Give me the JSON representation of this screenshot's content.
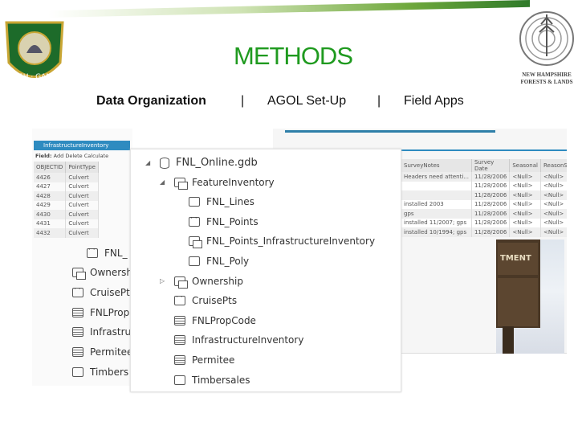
{
  "title": "METHODS",
  "nav": {
    "items": [
      "Data Organization",
      "AGOL Set-Up",
      "Field Apps"
    ],
    "separator": "|",
    "active": "Data Organization"
  },
  "logos": {
    "left": "FISH & GAME",
    "right": "NEW HAMPSHIRE FORESTS & LANDS"
  },
  "table_window": {
    "tab": "InfrastructureInventory",
    "toolbar": [
      "Field:",
      "Add",
      "Delete",
      "Calculate"
    ],
    "columns": [
      "OBJECTID",
      "PointType"
    ],
    "rows": [
      [
        "4426",
        "Culvert"
      ],
      [
        "4427",
        "Culvert"
      ],
      [
        "4428",
        "Culvert"
      ],
      [
        "4429",
        "Culvert"
      ],
      [
        "4430",
        "Culvert"
      ],
      [
        "4431",
        "Culvert"
      ],
      [
        "4432",
        "Culvert"
      ]
    ]
  },
  "table_right": {
    "columns": [
      "SurveyNotes",
      "Survey Date",
      "Seasonal",
      "ReasonSea"
    ],
    "rows": [
      [
        "Headers need attenti...",
        "11/28/2006",
        "<Null>",
        "<Null>"
      ],
      [
        "",
        "11/28/2006",
        "<Null>",
        "<Null>"
      ],
      [
        "",
        "11/28/2006",
        "<Null>",
        "<Null>"
      ],
      [
        "installed 2003",
        "11/28/2006",
        "<Null>",
        "<Null>"
      ],
      [
        "gps",
        "11/28/2006",
        "<Null>",
        "<Null>"
      ],
      [
        "installed 11/2007; gps",
        "11/28/2006",
        "<Null>",
        "<Null>"
      ],
      [
        "installed 10/1994; gps",
        "11/28/2006",
        "<Null>",
        "<Null>"
      ]
    ]
  },
  "back_tree": [
    "FNL_",
    "Ownersh",
    "CruisePt",
    "FNLProp",
    "Infrastru",
    "Permitee",
    "Timbers"
  ],
  "tree": [
    {
      "label": "FNL_Online.gdb",
      "icon": "database-icon",
      "level": 0,
      "expanded": true
    },
    {
      "label": "FeatureInventory",
      "icon": "feature-dataset-icon",
      "level": 1,
      "expanded": true
    },
    {
      "label": "FNL_Lines",
      "icon": "line-feature-icon",
      "level": 2
    },
    {
      "label": "FNL_Points",
      "icon": "point-feature-icon",
      "level": 2
    },
    {
      "label": "FNL_Points_InfrastructureInventory",
      "icon": "relationship-icon",
      "level": 2
    },
    {
      "label": "FNL_Poly",
      "icon": "polygon-feature-icon",
      "level": 2
    },
    {
      "label": "Ownership",
      "icon": "feature-dataset-icon",
      "level": 1,
      "expanded": false
    },
    {
      "label": "CruisePts",
      "icon": "point-feature-icon",
      "level": 1
    },
    {
      "label": "FNLPropCode",
      "icon": "table-icon",
      "level": 1
    },
    {
      "label": "InfrastructureInventory",
      "icon": "table-icon",
      "level": 1
    },
    {
      "label": "Permitee",
      "icon": "table-icon",
      "level": 1
    },
    {
      "label": "Timbersales",
      "icon": "polygon-feature-icon",
      "level": 1
    }
  ],
  "colors": {
    "title": "#1f9a1f",
    "accent": "#2e8bc0"
  }
}
